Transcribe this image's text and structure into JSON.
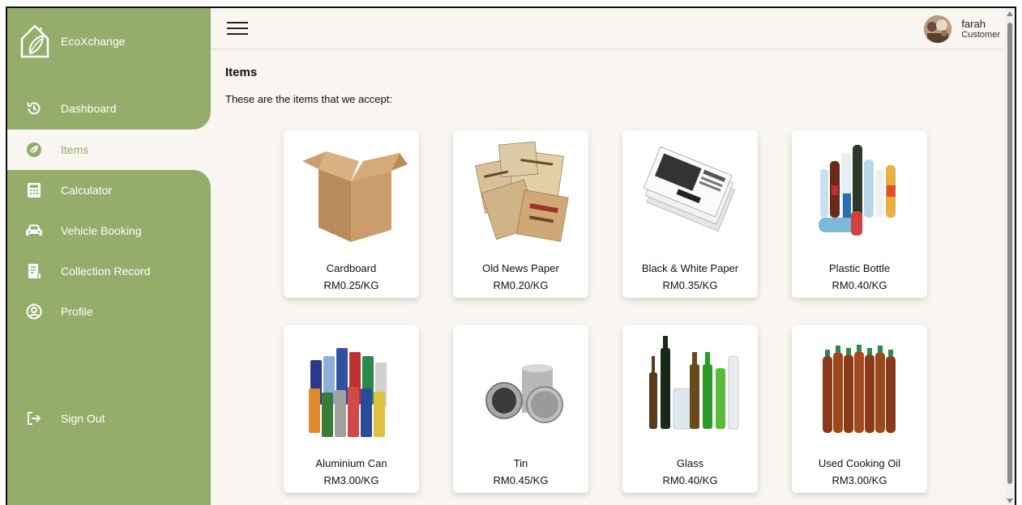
{
  "app": {
    "brand": "EcoXchange"
  },
  "sidebar": {
    "items": [
      {
        "label": "Dashboard",
        "icon": "dashboard-icon"
      },
      {
        "label": "Items",
        "icon": "leaf-icon",
        "active": true
      },
      {
        "label": "Calculator",
        "icon": "calculator-icon"
      },
      {
        "label": "Vehicle Booking",
        "icon": "car-icon"
      },
      {
        "label": "Collection Record",
        "icon": "record-icon"
      },
      {
        "label": "Profile",
        "icon": "profile-icon"
      }
    ],
    "signout": {
      "label": "Sign Out",
      "icon": "sign-out-icon"
    }
  },
  "header": {
    "user": {
      "name": "farah",
      "role": "Customer"
    }
  },
  "main": {
    "title": "Items",
    "description": "These are the items that we accept:",
    "items": [
      {
        "name": "Cardboard",
        "price": "RM0.25/KG"
      },
      {
        "name": "Old News Paper",
        "price": "RM0.20/KG"
      },
      {
        "name": "Black & White Paper",
        "price": "RM0.35/KG"
      },
      {
        "name": "Plastic Bottle",
        "price": "RM0.40/KG"
      },
      {
        "name": "Aluminium Can",
        "price": "RM3.00/KG"
      },
      {
        "name": "Tin",
        "price": "RM0.45/KG"
      },
      {
        "name": "Glass",
        "price": "RM0.40/KG"
      },
      {
        "name": "Used Cooking Oil",
        "price": "RM3.00/KG"
      }
    ]
  },
  "colors": {
    "sidebar": "#94ad6b",
    "background": "#f9f5f0"
  }
}
